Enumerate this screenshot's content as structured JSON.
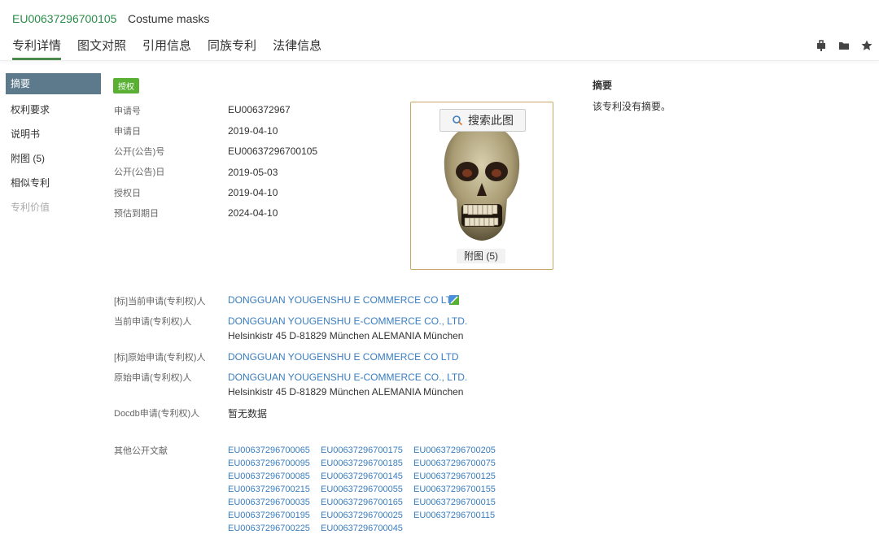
{
  "header": {
    "pub_number": "EU00637296700105",
    "title": "Costume masks",
    "tabs": [
      "专利详情",
      "图文对照",
      "引用信息",
      "同族专利",
      "法律信息"
    ]
  },
  "sidebar": {
    "items": [
      {
        "label": "摘要"
      },
      {
        "label": "权利要求"
      },
      {
        "label": "说明书"
      },
      {
        "label": "附图 (5)"
      },
      {
        "label": "相似专利"
      },
      {
        "label": "专利价值"
      }
    ]
  },
  "status_badge": "授权",
  "fields": [
    {
      "label": "申请号",
      "value": "EU006372967"
    },
    {
      "label": "申请日",
      "value": "2019-04-10"
    },
    {
      "label": "公开(公告)号",
      "value": "EU00637296700105"
    },
    {
      "label": "公开(公告)日",
      "value": "2019-05-03"
    },
    {
      "label": "授权日",
      "value": "2019-04-10"
    },
    {
      "label": "预估到期日",
      "value": "2024-04-10"
    }
  ],
  "image_panel": {
    "search_label": "搜索此图",
    "figures_label": "附图 (5)"
  },
  "applicants": {
    "std_current_label": "[标]当前申请(专利权)人",
    "std_current_value": "DONGGUAN YOUGENSHU E COMMERCE CO LTD",
    "current_label": "当前申请(专利权)人",
    "current_value": "DONGGUAN YOUGENSHU E-COMMERCE CO., LTD.",
    "current_address": "Helsinkistr 45 D-81829 München ALEMANIA München",
    "std_original_label": "[标]原始申请(专利权)人",
    "std_original_value": "DONGGUAN YOUGENSHU E COMMERCE CO LTD",
    "original_label": "原始申请(专利权)人",
    "original_value": "DONGGUAN YOUGENSHU E-COMMERCE CO., LTD.",
    "original_address": "Helsinkistr 45 D-81829 München ALEMANIA München",
    "docdb_label": "Docdb申请(专利权)人",
    "docdb_value": "暂无数据"
  },
  "other_docs": {
    "label": "其他公开文献",
    "items": [
      "EU00637296700065",
      "EU00637296700175",
      "EU00637296700205",
      "EU00637296700095",
      "EU00637296700185",
      "EU00637296700075",
      "EU00637296700085",
      "EU00637296700145",
      "EU00637296700125",
      "EU00637296700215",
      "EU00637296700055",
      "EU00637296700155",
      "EU00637296700035",
      "EU00637296700165",
      "EU00637296700015",
      "EU00637296700195",
      "EU00637296700025",
      "EU00637296700115",
      "EU00637296700225",
      "EU00637296700045"
    ]
  },
  "abstract": {
    "title": "摘要",
    "text": "该专利没有摘要。"
  },
  "colors": {
    "pub_number": "#2a8c4a",
    "link": "#3a7ec0",
    "badge": "#5ab033",
    "sidebar_active": "#5d7a8c",
    "image_border": "#c9a96b"
  },
  "icons": [
    "clip-icon",
    "folder-icon",
    "star-icon",
    "search-icon",
    "flag-icon"
  ]
}
